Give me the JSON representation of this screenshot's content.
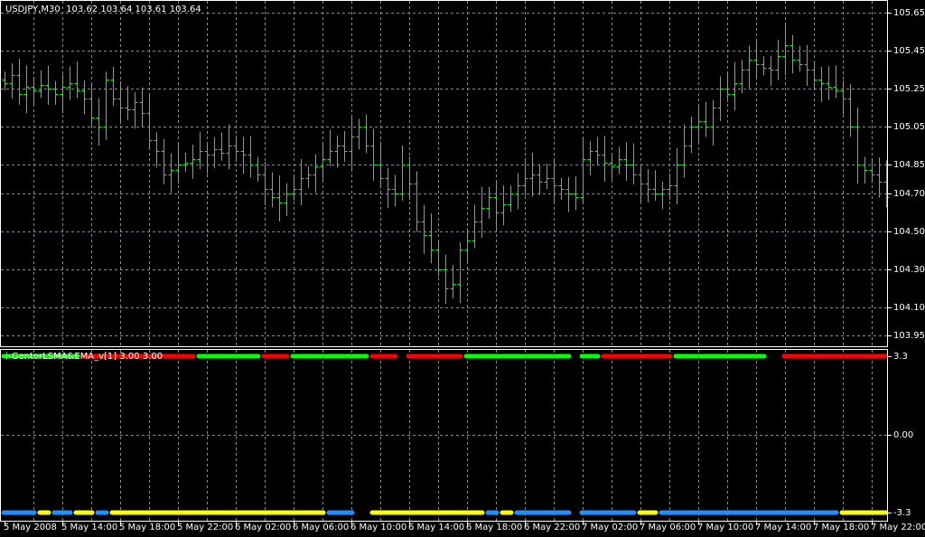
{
  "chart_header": {
    "symbol": "USDJPY,M30",
    "open": "103.62",
    "high": "103.64",
    "low": "103.61",
    "close": "103.64"
  },
  "indicator_header": {
    "name": "i-GentorLSMA&EMA_v[1]",
    "param1": "3.00",
    "param2": "3.00"
  },
  "colors": {
    "bars": "#00ff00",
    "grid": "#7f8c9c",
    "up": "#00ff00",
    "down": "#ff0000",
    "blue": "#1e90ff",
    "yellow": "#ffff00"
  },
  "chart_data": {
    "type": "ohlc",
    "price_ticks": [
      "105.65",
      "105.45",
      "105.25",
      "105.05",
      "104.85",
      "104.70",
      "104.50",
      "104.30",
      "104.10",
      "103.95"
    ],
    "price_range": [
      103.95,
      105.65
    ],
    "time_labels": [
      "5 May 2008",
      "5 May 14:00",
      "5 May 18:00",
      "5 May 22:00",
      "6 May 02:00",
      "6 May 06:00",
      "6 May 10:00",
      "6 May 14:00",
      "6 May 18:00",
      "6 May 22:00",
      "7 May 02:00",
      "7 May 06:00",
      "7 May 10:00",
      "7 May 14:00",
      "7 May 18:00",
      "7 May 22:00"
    ],
    "closes": [
      105.28,
      105.32,
      105.22,
      105.26,
      105.24,
      105.27,
      105.25,
      105.22,
      105.26,
      105.28,
      105.24,
      105.2,
      105.1,
      105.05,
      105.3,
      105.2,
      105.15,
      105.14,
      105.18,
      105.12,
      104.98,
      104.92,
      104.8,
      104.82,
      104.85,
      104.86,
      104.88,
      104.92,
      104.9,
      104.93,
      104.91,
      104.95,
      104.92,
      104.9,
      104.85,
      104.8,
      104.72,
      104.68,
      104.65,
      104.7,
      104.72,
      104.78,
      104.8,
      104.84,
      104.88,
      104.92,
      104.95,
      104.92,
      105.0,
      105.05,
      104.95,
      104.85,
      104.78,
      104.72,
      104.7,
      104.85,
      104.75,
      104.55,
      104.48,
      104.4,
      104.3,
      104.2,
      104.22,
      104.4,
      104.45,
      104.55,
      104.62,
      104.68,
      104.6,
      104.64,
      104.7,
      104.74,
      104.78,
      104.8,
      104.76,
      104.78,
      104.74,
      104.72,
      104.7,
      104.68,
      104.88,
      104.92,
      104.9,
      104.86,
      104.84,
      104.88,
      104.85,
      104.8,
      104.75,
      104.72,
      104.7,
      104.72,
      104.74,
      104.85,
      104.95,
      105.05,
      105.08,
      105.05,
      105.15,
      105.25,
      105.22,
      105.28,
      105.35,
      105.4,
      105.38,
      105.36,
      105.35,
      105.42,
      105.48,
      105.4,
      105.38,
      105.35,
      105.3,
      105.28,
      105.26,
      105.24,
      105.2,
      105.05,
      104.85,
      104.82,
      104.8,
      104.76,
      104.68
    ],
    "indicator": {
      "ticks": [
        "3.3",
        "0.00",
        "-3.3"
      ],
      "range": [
        -3.3,
        3.3
      ],
      "upper_level": 3.0,
      "lower_level": -3.0,
      "upper_segments": [
        [
          0,
          10,
          "up"
        ],
        [
          11,
          26,
          "down"
        ],
        [
          27,
          35,
          "up"
        ],
        [
          36,
          39,
          "down"
        ],
        [
          40,
          50,
          "up"
        ],
        [
          51,
          54,
          "down"
        ],
        [
          56,
          63,
          "down"
        ],
        [
          64,
          78,
          "up"
        ],
        [
          80,
          82,
          "up"
        ],
        [
          83,
          92,
          "down"
        ],
        [
          93,
          105,
          "up"
        ],
        [
          108,
          122,
          "down"
        ]
      ],
      "lower_segments": [
        [
          0,
          4,
          "blue"
        ],
        [
          5,
          6,
          "yellow"
        ],
        [
          7,
          9,
          "blue"
        ],
        [
          10,
          12,
          "yellow"
        ],
        [
          13,
          14,
          "blue"
        ],
        [
          15,
          44,
          "yellow"
        ],
        [
          45,
          48,
          "blue"
        ],
        [
          51,
          66,
          "yellow"
        ],
        [
          67,
          68,
          "blue"
        ],
        [
          69,
          70,
          "yellow"
        ],
        [
          71,
          78,
          "blue"
        ],
        [
          80,
          87,
          "blue"
        ],
        [
          88,
          90,
          "yellow"
        ],
        [
          91,
          115,
          "blue"
        ],
        [
          116,
          122,
          "yellow"
        ]
      ]
    }
  }
}
